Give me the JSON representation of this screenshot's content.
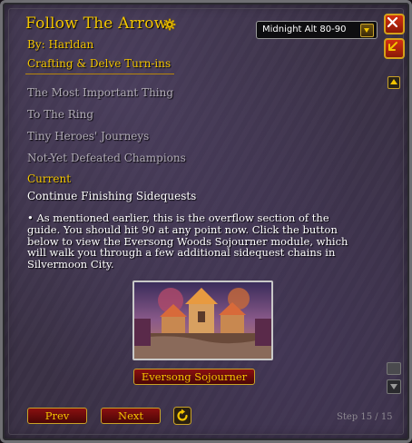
{
  "header": {
    "title": "Follow The Arrow",
    "author": "By: Harldan",
    "category": "Crafting & Delve Turn-ins"
  },
  "profile_select": {
    "value": "Midnight Alt 80-90"
  },
  "steps": {
    "completed": [
      "The Most Important Thing",
      "To The Ring",
      "Tiny Heroes' Journeys",
      "Not-Yet Defeated Champions"
    ],
    "current_label": "Current",
    "current": "Continue Finishing Sidequests",
    "description": "• As mentioned earlier, this is the overflow section of the guide. You should hit 90 at any point now. Click the button below to view the Eversong Woods Sojourner module, which will walk you through a few additional sidequest chains in Silvermoon City."
  },
  "module_button": "Eversong Sojourner",
  "nav": {
    "prev": "Prev",
    "next": "Next"
  },
  "step_counter": "Step 15 / 15",
  "icons": {
    "gear": "gear-icon",
    "close": "close-icon",
    "back": "back-arrow-icon",
    "refresh": "refresh-icon",
    "dropdown": "chevron-down-icon"
  },
  "colors": {
    "gold": "#f2c400",
    "button_red": "#8a1010",
    "muted_text": "#b1acb6",
    "panel_bg": "#3a3145"
  }
}
